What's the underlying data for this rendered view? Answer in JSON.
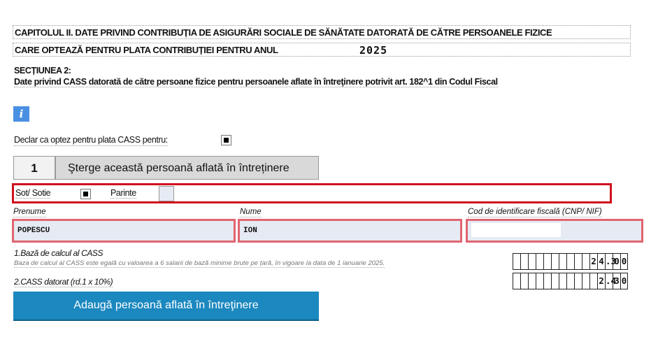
{
  "header": {
    "line1": "CAPITOLUL II. DATE PRIVIND CONTRIBUȚIA DE ASIGURĂRI SOCIALE DE SĂNĂTATE DATORATĂ DE CĂTRE PERSOANELE FIZICE",
    "line2": "CARE OPTEAZĂ PENTRU PLATA CONTRIBUȚIEI  PENTRU ANUL",
    "year": "2025"
  },
  "section": {
    "title": "SECȚIUNEA 2:",
    "subtitle": "Date privind CASS datorată de către persoane fizice pentru persoanele aflate în întreţinere potrivit art. 182^1 din Codul Fiscal"
  },
  "info_button": "i",
  "declaration": {
    "label": "Declar ca optez pentru plata CASS pentru:",
    "checked": true
  },
  "person": {
    "number": "1",
    "delete_label": "Şterge această persoană aflată în întreținere",
    "relation": {
      "spouse_label": "Sot/ Sotie",
      "spouse_checked": true,
      "parent_label": "Parinte",
      "parent_checked": false
    },
    "first_name_label": "Prenume",
    "first_name_value": "POPESCU",
    "last_name_label": "Nume",
    "last_name_value": "ION",
    "cnp_label": "Cod de identificare fiscală (CNP/ NIF)",
    "cnp_value": ""
  },
  "calc": {
    "row1_label": "1.Bază de calcul al CASS",
    "row1_note": "Baza de calcul al CASS este egală cu valoarea a 6 salarii de bază minime brute pe țară, în vigoare la data de 1 ianuarie 2025.",
    "row1_digits": [
      "",
      "",
      "",
      "",
      "",
      "",
      "",
      "",
      "",
      "",
      "2",
      "4",
      ".3",
      "0",
      "0"
    ],
    "row2_label": "2.CASS datorat (rd.1 x 10%)",
    "row2_digits": [
      "",
      "",
      "",
      "",
      "",
      "",
      "",
      "",
      "",
      "",
      "",
      "2",
      ".4",
      "3",
      "0"
    ]
  },
  "add_button": "Adaugă persoană aflată în întreţinere",
  "colors": {
    "accent_blue": "#1b88bf",
    "info_blue": "#4a90e2",
    "error_red": "#d0101c",
    "field_bg": "#e6eaf3"
  }
}
